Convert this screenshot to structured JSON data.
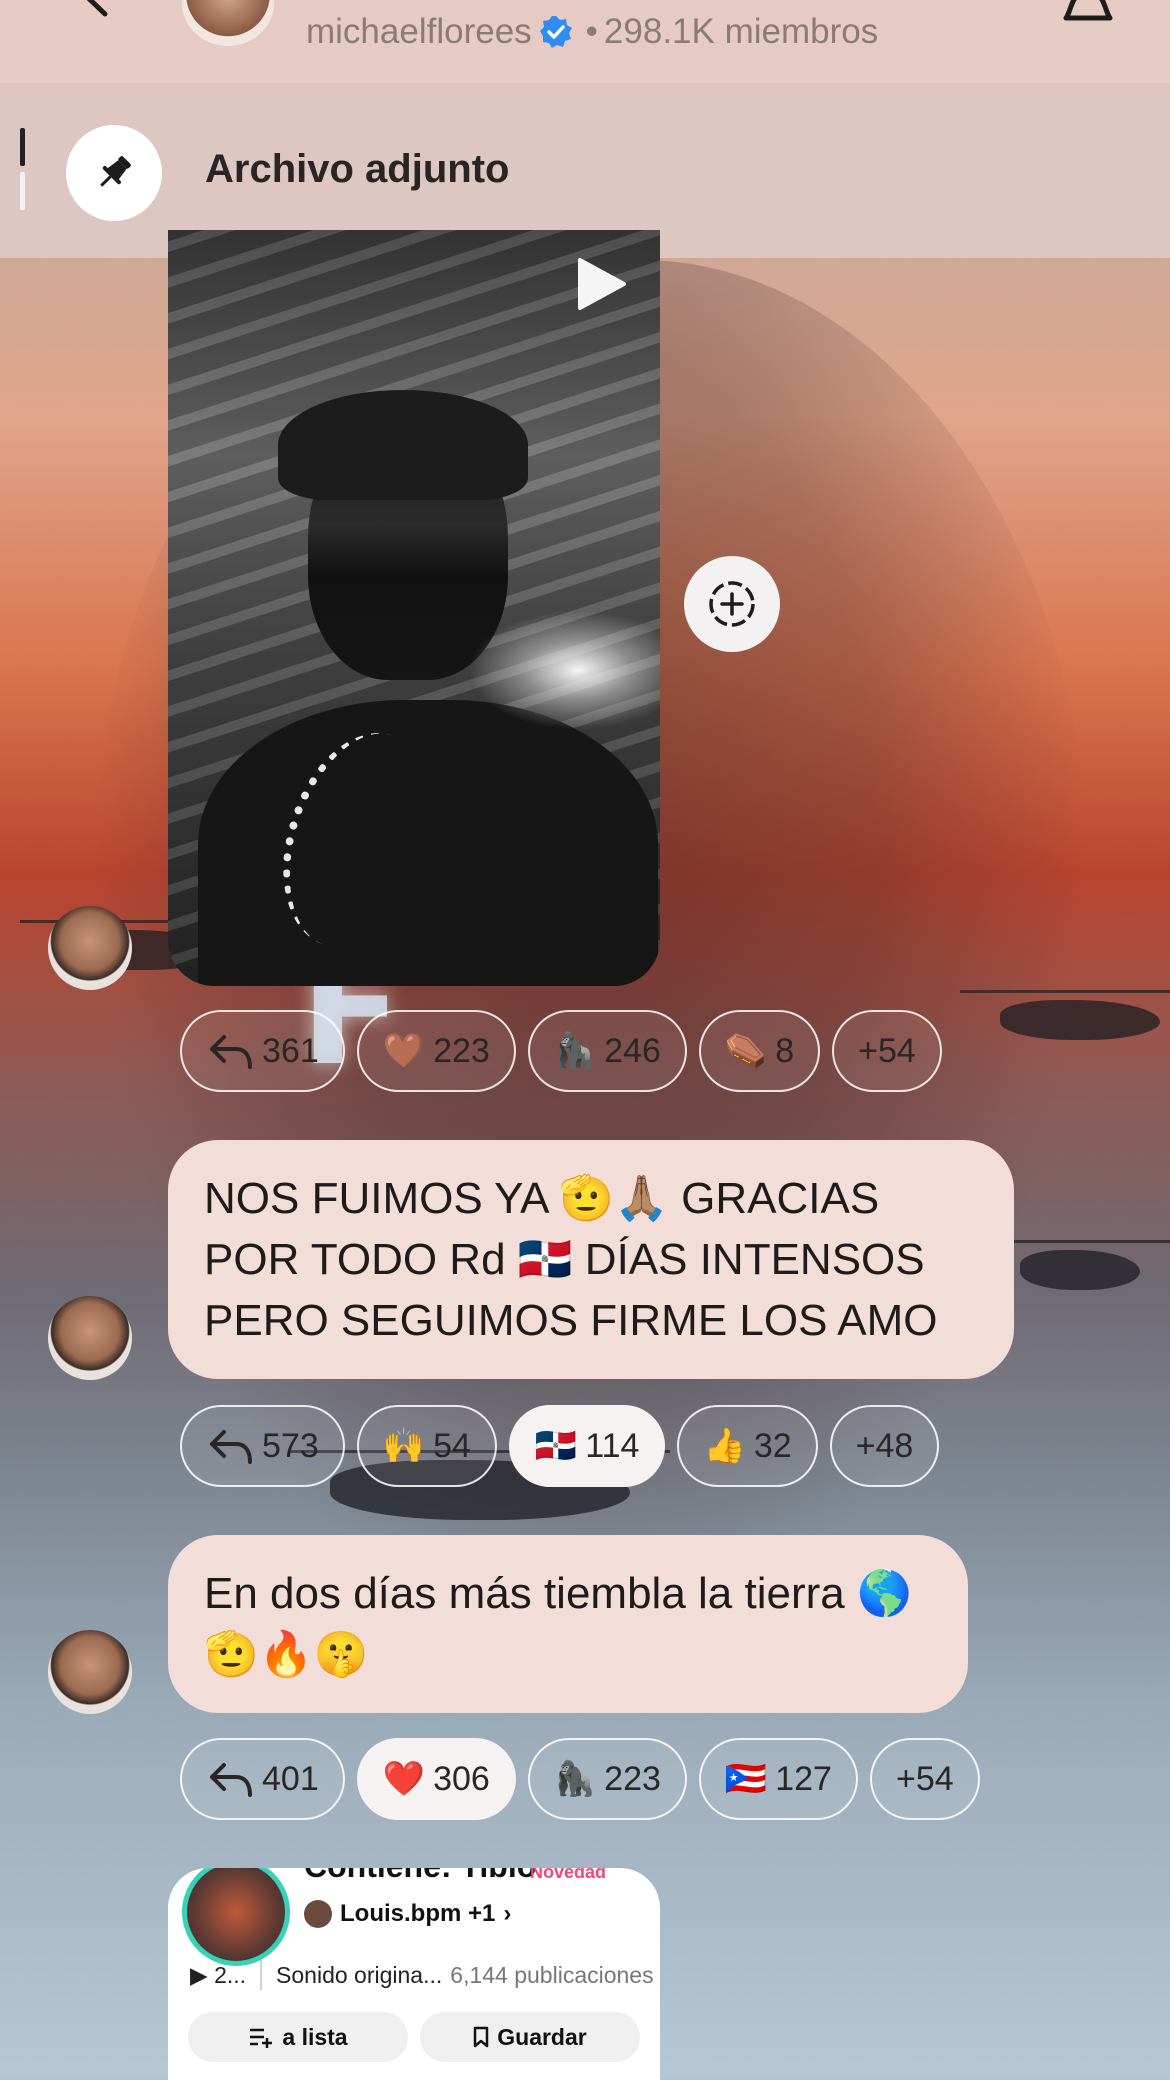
{
  "header": {
    "channel_name": "michaelflorees",
    "member_count": "298.1K miembros"
  },
  "pinned": {
    "label": "Archivo adjunto"
  },
  "video_post": {
    "reactions": [
      {
        "emoji": "",
        "count": "361",
        "kind": "reply"
      },
      {
        "emoji": "🤎",
        "count": "223",
        "kind": "emoji"
      },
      {
        "emoji": "🦍",
        "count": "246",
        "kind": "emoji"
      },
      {
        "emoji": "⚰️",
        "count": "8",
        "kind": "emoji"
      },
      {
        "emoji": "",
        "count": "+54",
        "kind": "more"
      }
    ]
  },
  "messages": [
    {
      "text": "NOS FUIMOS YA 🫡🙏🏽 GRACIAS POR TODO Rd 🇩🇴 DÍAS INTENSOS PERO SEGUIMOS FIRME LOS AMO",
      "reactions": [
        {
          "emoji": "",
          "count": "573",
          "kind": "reply"
        },
        {
          "emoji": "🙌",
          "count": "54",
          "kind": "emoji"
        },
        {
          "emoji": "🇩🇴",
          "count": "114",
          "kind": "emoji",
          "selected": true
        },
        {
          "emoji": "👍",
          "count": "32",
          "kind": "emoji"
        },
        {
          "emoji": "",
          "count": "+48",
          "kind": "more"
        }
      ]
    },
    {
      "text": "En dos días  más tiembla la tierra 🌎  🫡🔥🤫",
      "reactions": [
        {
          "emoji": "",
          "count": "401",
          "kind": "reply"
        },
        {
          "emoji": "❤️",
          "count": "306",
          "kind": "emoji",
          "selected": true
        },
        {
          "emoji": "🦍",
          "count": "223",
          "kind": "emoji"
        },
        {
          "emoji": "🇵🇷",
          "count": "127",
          "kind": "emoji"
        },
        {
          "emoji": "",
          "count": "+54",
          "kind": "more"
        }
      ]
    }
  ],
  "sound_card": {
    "title": "Contiene: Tibio",
    "badge": "Novedad",
    "author": "Louis.bpm +1",
    "plays": "2...",
    "sound_name": "Sonido origina...",
    "post_count": "6,144 publicaciones",
    "add_to_list": "a lista",
    "save": "Guardar"
  },
  "colors": {
    "header_bg": "#e6cbc4",
    "bubble_bg": "#f2ddd8",
    "verified": "#2f8cf0",
    "selected_chip": "#f7f2f2"
  }
}
